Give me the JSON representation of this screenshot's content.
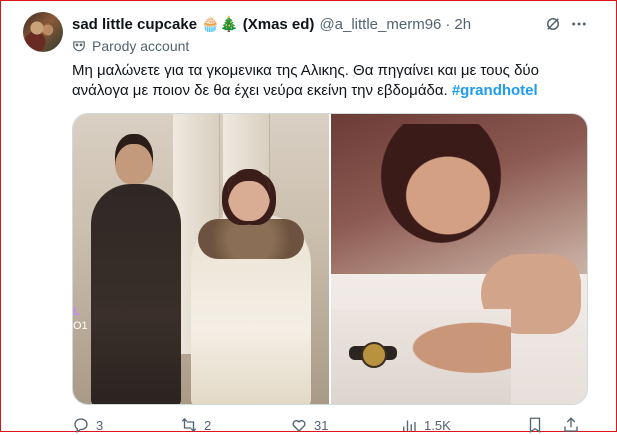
{
  "tweet": {
    "display_name": "sad little cupcake 🧁🎄 (Xmas ed)",
    "handle": "@a_little_merm96",
    "separator": "·",
    "time": "2h",
    "label": "Parody account",
    "text_main": "Μη μαλώνετε για τα γκομενικα της Αλικης. Θα πηγαίνει και με τους δύο ανάλογα με ποιον δε θα έχει νεύρα εκείνη την εβδομάδα. ",
    "hashtag": "#grandhotel",
    "media_overlay_top": "L",
    "media_overlay_bottom": "O1"
  },
  "actions": {
    "replies": "3",
    "reposts": "2",
    "likes": "31",
    "views": "1.5K"
  },
  "icons": {
    "label": "parody-mask-icon",
    "grok": "grok-icon",
    "more": "more-icon",
    "reply": "reply-icon",
    "repost": "repost-icon",
    "like": "heart-icon",
    "views": "views-icon",
    "bookmark": "bookmark-icon",
    "share": "share-icon"
  },
  "colors": {
    "frame": "#e0141e",
    "hashtag": "#1d9bf0",
    "secondary_text": "#536471",
    "watermark": "#c68af0"
  }
}
